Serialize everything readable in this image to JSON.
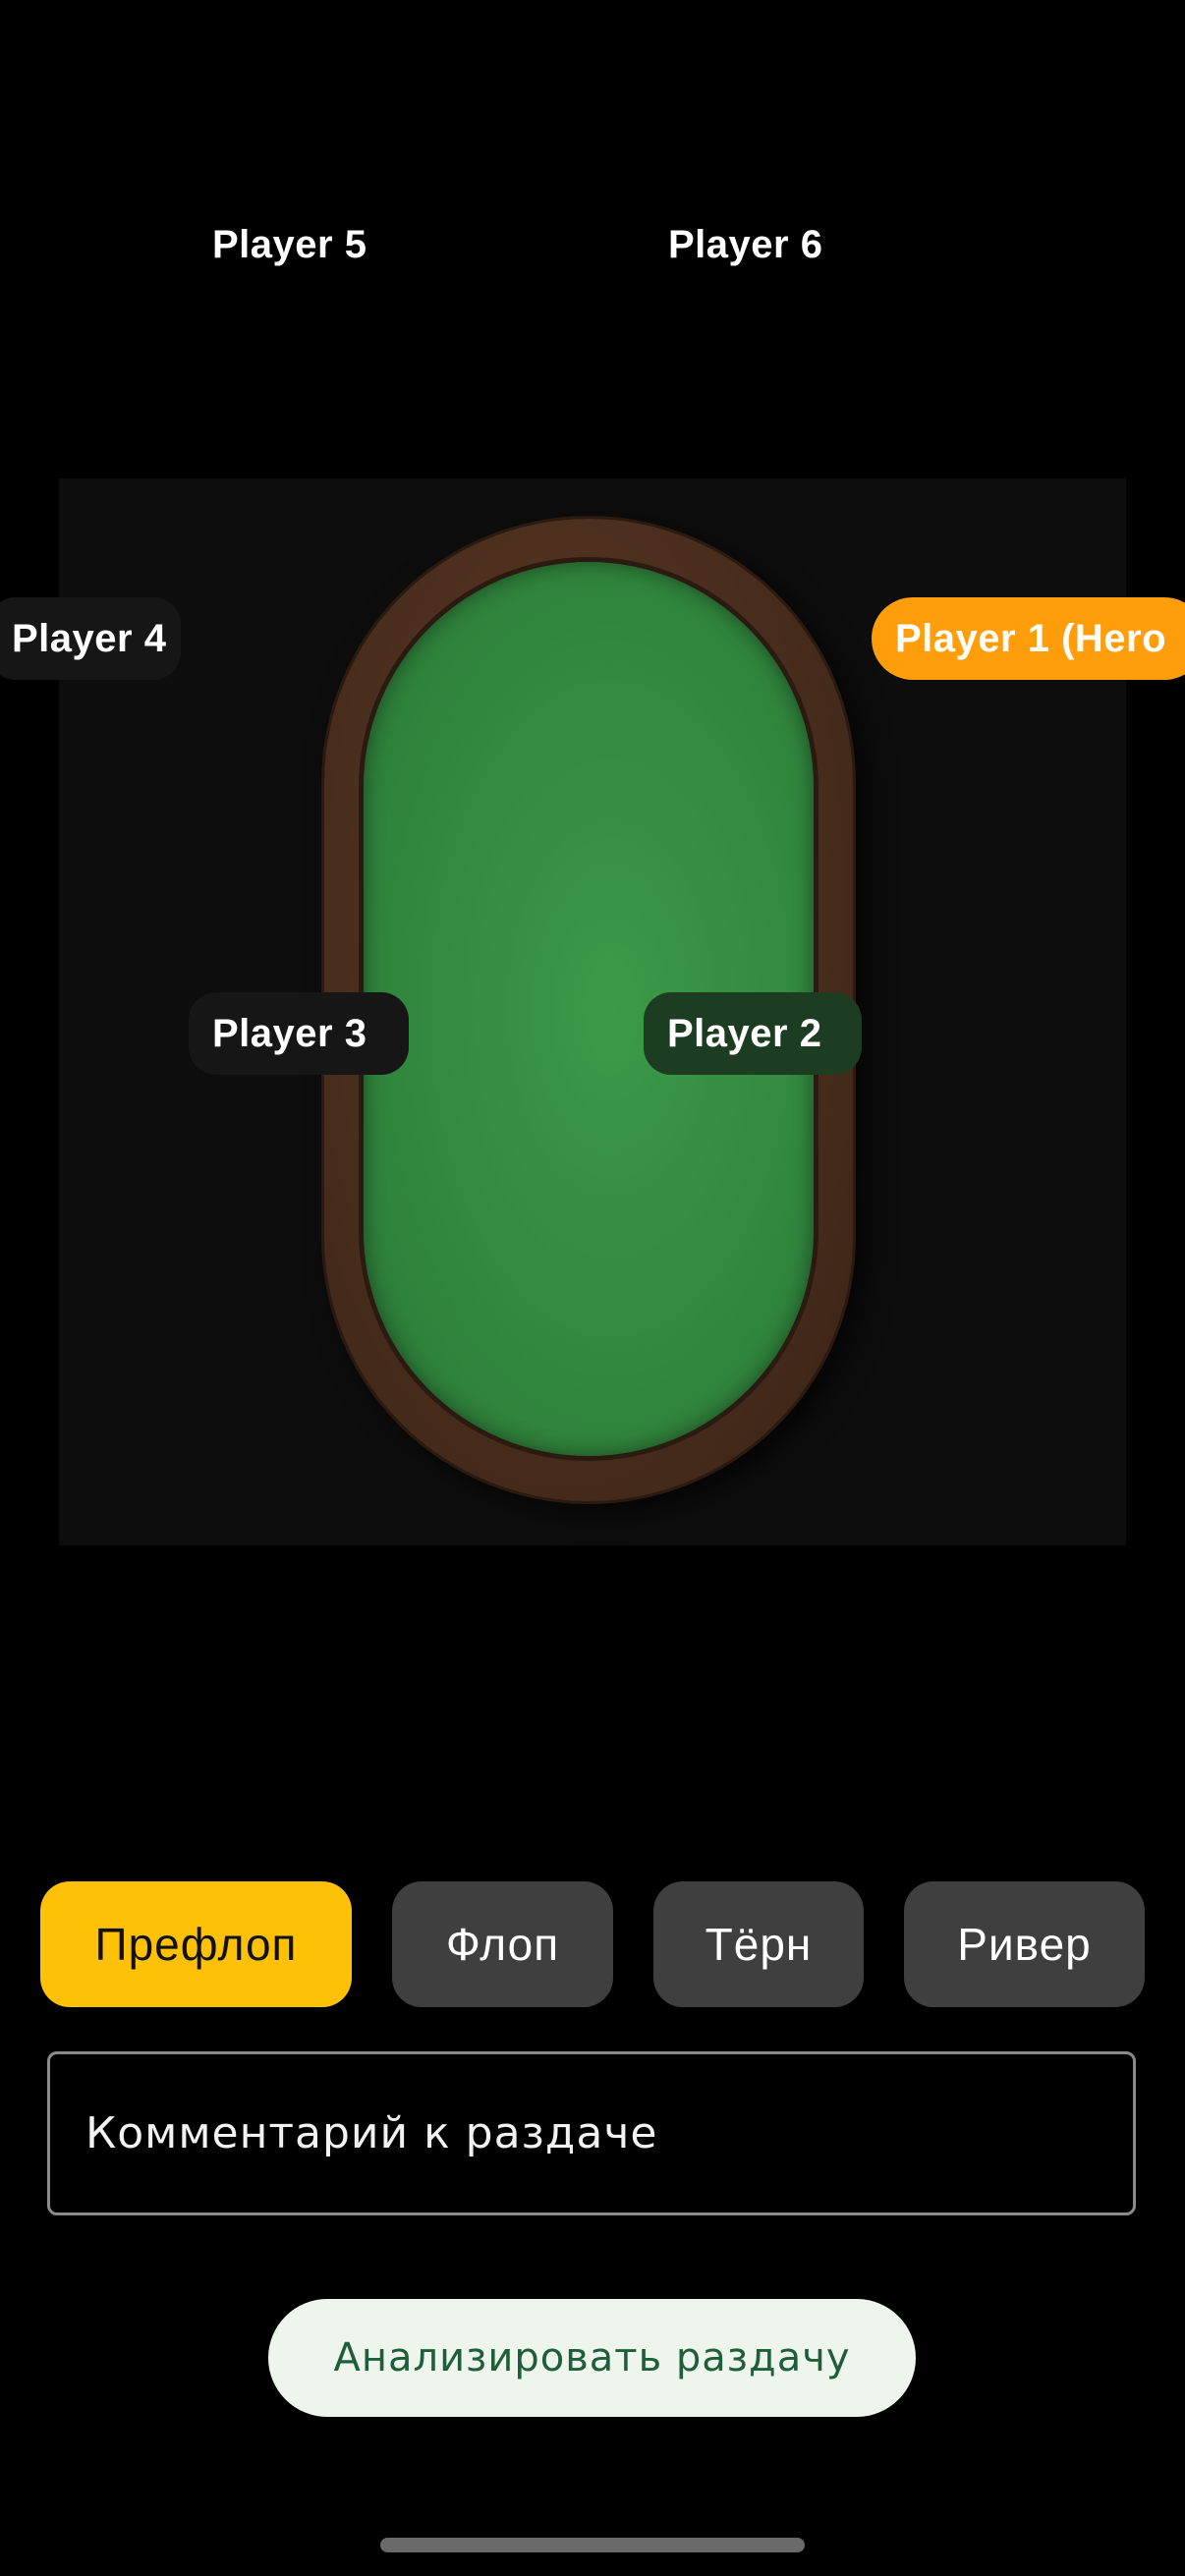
{
  "players": {
    "p5": "Player 5",
    "p6": "Player 6",
    "p4": "Player 4",
    "p1_hero": "Player 1 (Hero",
    "p3": "Player 3",
    "p2": "Player 2"
  },
  "streets": [
    {
      "label": "Префлоп",
      "active": true
    },
    {
      "label": "Флоп",
      "active": false
    },
    {
      "label": "Тёрн",
      "active": false
    },
    {
      "label": "Ривер",
      "active": false
    }
  ],
  "comment": {
    "placeholder": "Комментарий к раздаче",
    "value": ""
  },
  "analyze_button": {
    "label": "Анализировать раздачу"
  },
  "colors": {
    "active_street": "#ffc107",
    "hero_badge": "#ff9d0a",
    "felt": "#338a40",
    "rail": "#4a2e1d"
  }
}
